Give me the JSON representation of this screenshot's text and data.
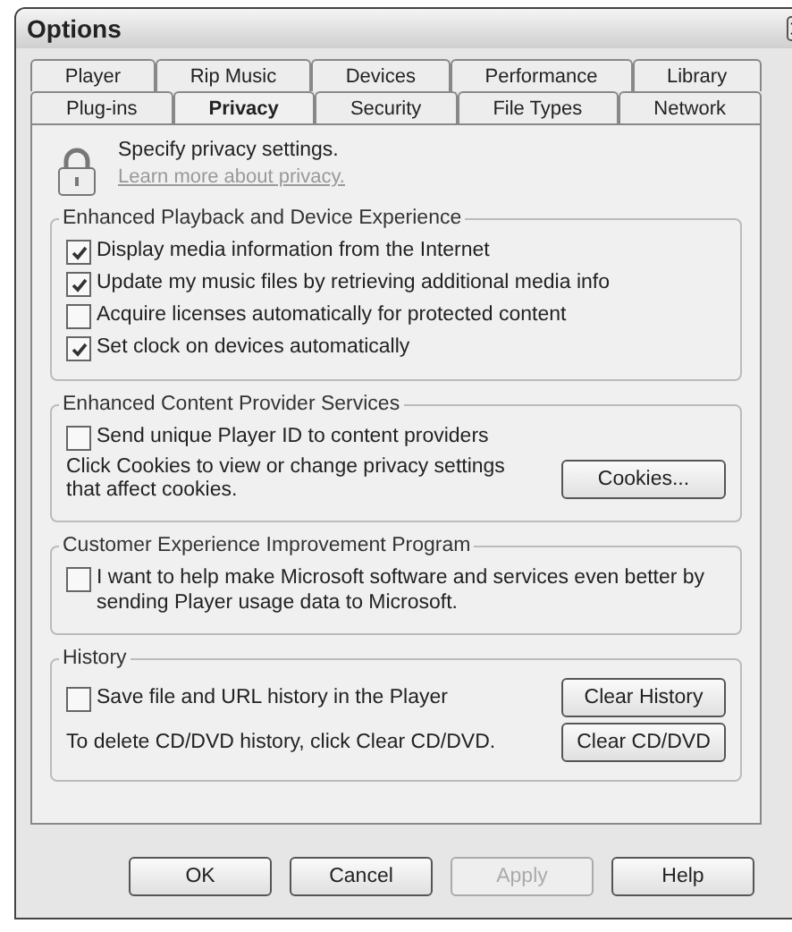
{
  "window": {
    "title": "Options"
  },
  "tab_rows": [
    [
      {
        "label": "Player",
        "selected": false
      },
      {
        "label": "Rip Music",
        "selected": false
      },
      {
        "label": "Devices",
        "selected": false
      },
      {
        "label": "Performance",
        "selected": false
      },
      {
        "label": "Library",
        "selected": false
      }
    ],
    [
      {
        "label": "Plug-ins",
        "selected": false
      },
      {
        "label": "Privacy",
        "selected": true
      },
      {
        "label": "Security",
        "selected": false
      },
      {
        "label": "File Types",
        "selected": false
      },
      {
        "label": "Network",
        "selected": false
      }
    ]
  ],
  "header": {
    "text": "Specify privacy settings.",
    "link": "Learn more about privacy."
  },
  "groups": [
    {
      "title": "Enhanced Playback and Device Experience",
      "items": [
        {
          "kind": "checkbox",
          "label": "Display media information from the Internet",
          "checked": true
        },
        {
          "kind": "checkbox",
          "label": "Update my music files by retrieving additional media info",
          "checked": true
        },
        {
          "kind": "checkbox",
          "label": "Acquire licenses automatically for protected content",
          "checked": false
        },
        {
          "kind": "checkbox",
          "label": "Set clock on devices automatically",
          "checked": true
        }
      ]
    },
    {
      "title": "Enhanced Content Provider Services",
      "items": [
        {
          "kind": "checkbox",
          "label": "Send unique Player ID to content providers",
          "checked": false
        },
        {
          "kind": "text_button",
          "text": "Click Cookies to view or change privacy settings that affect cookies.",
          "button": "Cookies..."
        }
      ]
    },
    {
      "title": "Customer Experience Improvement Program",
      "items": [
        {
          "kind": "checkbox",
          "label": "I want to help make Microsoft software and services even better by sending Player usage data to Microsoft.",
          "checked": false
        }
      ]
    },
    {
      "title": "History",
      "items": [
        {
          "kind": "checkbox_button",
          "label": "Save file and URL history in the Player",
          "checked": false,
          "button": "Clear History"
        },
        {
          "kind": "text_button",
          "text": "To delete  CD/DVD history, click Clear CD/DVD.",
          "button": "Clear CD/DVD"
        }
      ]
    }
  ],
  "buttons": [
    {
      "label": "OK",
      "disabled": false
    },
    {
      "label": "Cancel",
      "disabled": false
    },
    {
      "label": "Apply",
      "disabled": true
    },
    {
      "label": "Help",
      "disabled": false
    }
  ]
}
